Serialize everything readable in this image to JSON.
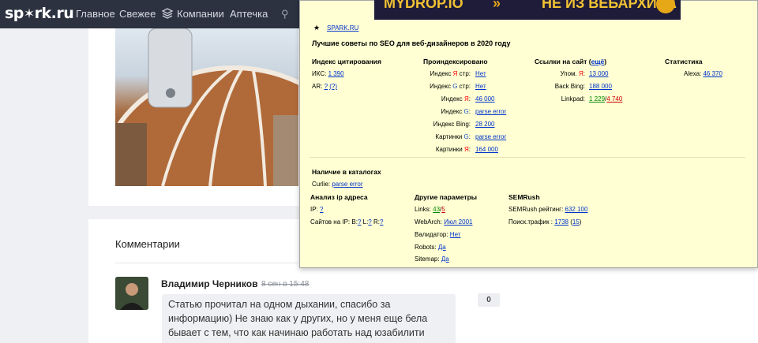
{
  "nav": {
    "logo_left": "sp",
    "logo_right": "rk.ru",
    "items": [
      "Главное",
      "Свежее",
      "Компании",
      "Аптечка"
    ]
  },
  "banner": {
    "left_text": "MYDROP.IO",
    "arrows": "»",
    "right_text": "НЕ ИЗ ВЕБАРХИВА"
  },
  "seo": {
    "site": "SPARK.RU",
    "title": "Лучшие советы по SEO для веб-дизайнеров в 2020 году",
    "citation": {
      "heading": "Индекс цитирования",
      "iks_label": "ИКС:",
      "iks_value": "1 390",
      "ar_label": "AR:",
      "ar_value1": "?",
      "ar_value2": "(?)"
    },
    "indexed": {
      "heading": "Проиндексировано",
      "rows": [
        {
          "pre": "Индекс ",
          "mark": "Я",
          "post": " стр:",
          "value": "Нет"
        },
        {
          "pre": "Индекс ",
          "mark": "G",
          "post": " стр:",
          "value": "Нет"
        },
        {
          "pre": "Индекс ",
          "mark": "Я",
          "post": ":",
          "value": "46 000"
        },
        {
          "pre": "Индекс ",
          "mark": "G",
          "post": ":",
          "value": "parse error"
        },
        {
          "pre": "Индекс Bing:",
          "mark": "",
          "post": "",
          "value": "28 200"
        },
        {
          "pre": "Картинки ",
          "mark": "G",
          "post": ":",
          "value": "parse error"
        },
        {
          "pre": "Картинки ",
          "mark": "Я",
          "post": ":",
          "value": "164 000"
        }
      ]
    },
    "links": {
      "heading": "Ссылки на сайт",
      "more": "ещё",
      "mentions_pre": "Упом. ",
      "mentions_mark": "Я",
      "mentions_post": ":",
      "mentions_value": "13 000",
      "bing_label": "Back Bing:",
      "bing_value": "188 000",
      "linkpad_label": "Linkpad:",
      "linkpad_value1": "1 229",
      "linkpad_sep": "/",
      "linkpad_value2": "4 740"
    },
    "stats": {
      "heading": "Статистика",
      "alexa_label": "Alexa:",
      "alexa_value": "46 370"
    },
    "catalogs": {
      "heading": "Наличие в каталогах",
      "curlie_label": "Curlie:",
      "curlie_value": "parse error"
    },
    "ip": {
      "heading": "Анализ ip адреса",
      "ip_label": "IP:",
      "ip_value": "?",
      "sites_label": "Сайтов на IP: B:",
      "sites_b": "?",
      "sites_l_label": " L:",
      "sites_l": "?",
      "sites_r_label": " R:",
      "sites_r": "?"
    },
    "other": {
      "heading": "Другие параметры",
      "links_label": "Links:",
      "links_value1": "43",
      "links_sep": "/",
      "links_value2": "5",
      "webarch_label": "WebArch:",
      "webarch_value": "Июл 2001",
      "validator_label": "Валидатор:",
      "validator_value": "Нет",
      "robots_label": "Robots:",
      "robots_value": "Да",
      "sitemap_label": "Sitemap:",
      "sitemap_value": "Да"
    },
    "semrush": {
      "heading": "SEMRush",
      "rating_label": "SEMRush рейтинг:",
      "rating_value": "632 100",
      "traffic_label": "Поиск.трафик :",
      "traffic_value": "1738",
      "traffic_extra": "15"
    }
  },
  "comments": {
    "heading": "Комментарии",
    "author": "Владимир Черников",
    "time": "8 сен в 15:48",
    "text": "Статью прочитал на одном дыхании, спасибо за информацию) Не знаю как у других, но у меня еще бела бывает с тем, что как начинаю работать над юзабилити",
    "votes": "0"
  }
}
